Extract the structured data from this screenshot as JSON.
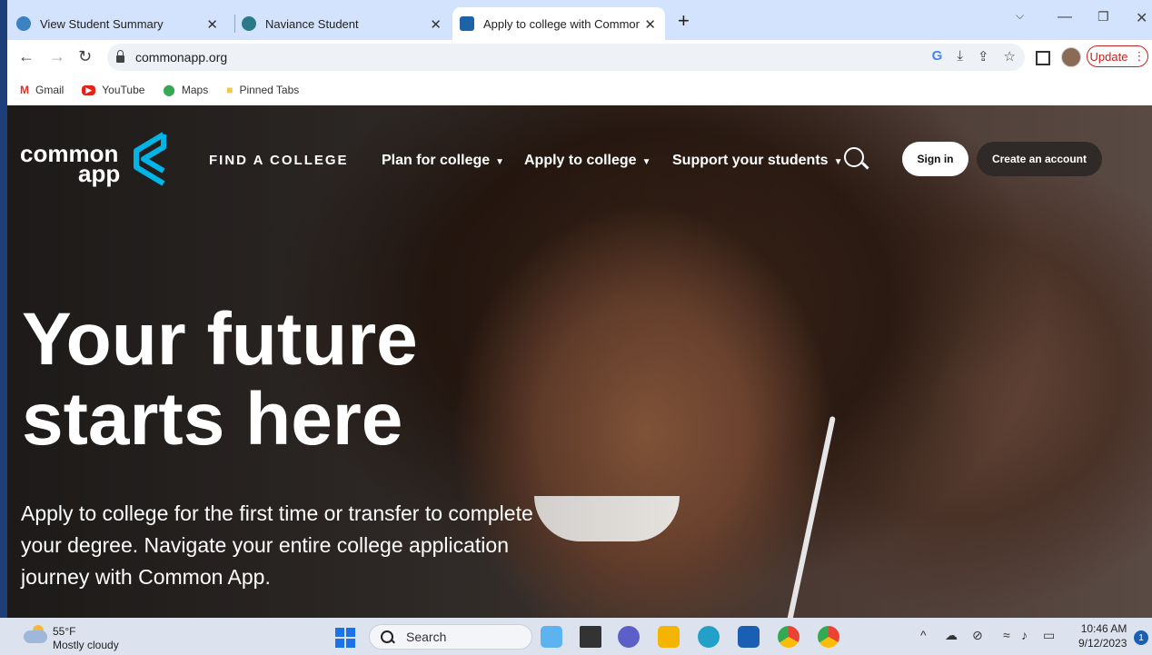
{
  "browser": {
    "tabs": [
      {
        "title": "View Student Summary",
        "active": false
      },
      {
        "title": "Naviance Student",
        "active": false
      },
      {
        "title": "Apply to college with Common A",
        "active": true
      }
    ],
    "new_tab": "+",
    "close_glyph": "✕",
    "url": "commonapp.org",
    "update_label": "Update",
    "bookmarks": [
      {
        "label": "Gmail",
        "icon": "gmail-icon"
      },
      {
        "label": "YouTube",
        "icon": "youtube-icon"
      },
      {
        "label": "Maps",
        "icon": "maps-icon"
      },
      {
        "label": "Pinned Tabs",
        "icon": "folder-icon"
      }
    ]
  },
  "site": {
    "logo_line1": "common",
    "logo_line2": "app",
    "nav": {
      "find": "FIND A COLLEGE",
      "plan": "Plan for college",
      "apply": "Apply to college",
      "support": "Support your students"
    },
    "signin": "Sign in",
    "create": "Create an account",
    "hero_line1": "Your future",
    "hero_line2": "starts here",
    "subtitle": "Apply to college for the first time or transfer to complete your degree. Navigate your entire college application journey with Common App.",
    "brand_color": "#00b4e5"
  },
  "taskbar": {
    "temp": "55°F",
    "weather": "Mostly cloudy",
    "search": "Search",
    "time": "10:46 AM",
    "date": "9/12/2023",
    "notifications": "1"
  }
}
